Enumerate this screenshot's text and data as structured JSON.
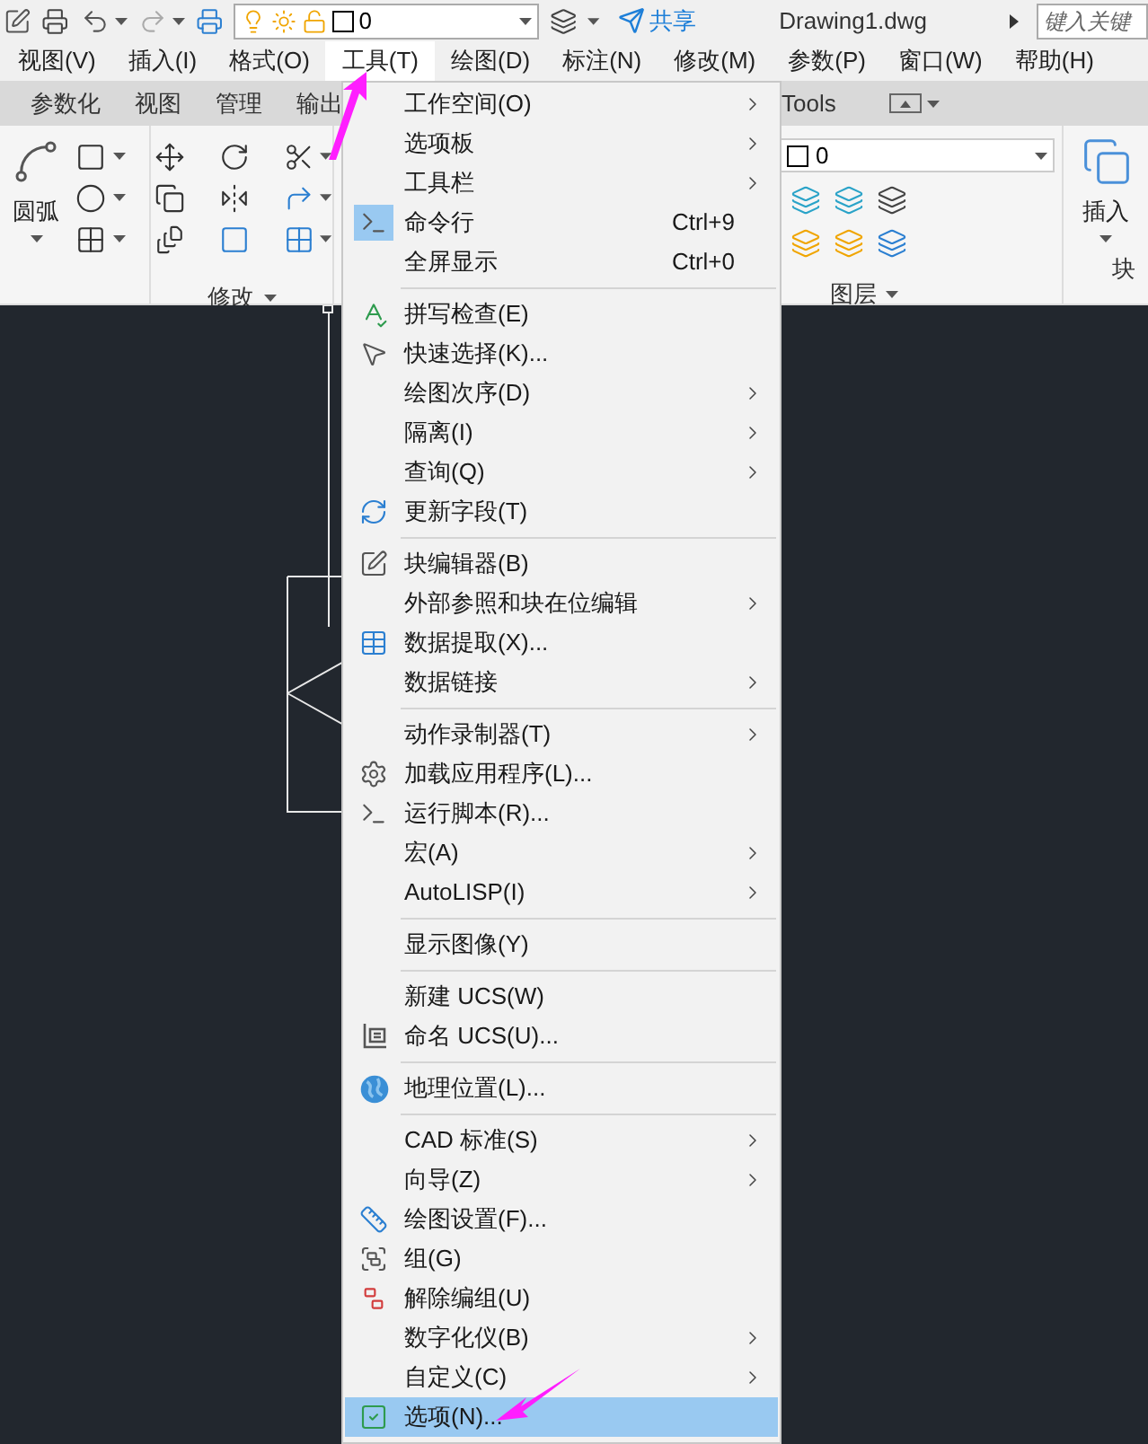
{
  "quick_access": {
    "layer_value": "0",
    "share": "共享",
    "document_title": "Drawing1.dwg",
    "search": {
      "placeholder": "键入关键"
    }
  },
  "menu_bar": [
    {
      "label": "视图(V)",
      "selected": false
    },
    {
      "label": "插入(I)",
      "selected": false
    },
    {
      "label": "格式(O)",
      "selected": false
    },
    {
      "label": "工具(T)",
      "selected": true
    },
    {
      "label": "绘图(D)",
      "selected": false
    },
    {
      "label": "标注(N)",
      "selected": false
    },
    {
      "label": "修改(M)",
      "selected": false
    },
    {
      "label": "参数(P)",
      "selected": false
    },
    {
      "label": "窗口(W)",
      "selected": false
    },
    {
      "label": "帮助(H)",
      "selected": false
    }
  ],
  "ribbon_tabs": [
    {
      "label": "参数化"
    },
    {
      "label": "视图"
    },
    {
      "label": "管理"
    },
    {
      "label": "输出"
    },
    {
      "label": "Tools"
    }
  ],
  "ribbon_panels": {
    "draw_button": "圆弧",
    "modify_label": "修改",
    "layer_value": "0",
    "layer_label": "图层",
    "insert_button": "插入",
    "block_label": "块"
  },
  "tools_menu": {
    "groups": [
      [
        {
          "label": "工作空间(O)",
          "submenu": true,
          "checked": false,
          "selected": false
        },
        {
          "label": "选项板",
          "submenu": true,
          "checked": false,
          "selected": false
        },
        {
          "label": "工具栏",
          "submenu": true,
          "checked": false,
          "selected": false
        },
        {
          "label": "命令行",
          "shortcut": "Ctrl+9",
          "submenu": false,
          "checked": true,
          "selected": false
        },
        {
          "label": "全屏显示",
          "shortcut": "Ctrl+0",
          "submenu": false,
          "checked": false,
          "selected": false
        }
      ],
      [
        {
          "label": "拼写检查(E)",
          "submenu": false,
          "checked": false,
          "selected": false
        },
        {
          "label": "快速选择(K)...",
          "submenu": false,
          "checked": false,
          "selected": false
        },
        {
          "label": "绘图次序(D)",
          "submenu": true,
          "checked": false,
          "selected": false
        },
        {
          "label": "隔离(I)",
          "submenu": true,
          "checked": false,
          "selected": false
        },
        {
          "label": "查询(Q)",
          "submenu": true,
          "checked": false,
          "selected": false
        },
        {
          "label": "更新字段(T)",
          "submenu": false,
          "checked": false,
          "selected": false
        }
      ],
      [
        {
          "label": "块编辑器(B)",
          "submenu": false,
          "checked": false,
          "selected": false
        },
        {
          "label": "外部参照和块在位编辑",
          "submenu": true,
          "checked": false,
          "selected": false
        },
        {
          "label": "数据提取(X)...",
          "submenu": false,
          "checked": false,
          "selected": false
        },
        {
          "label": "数据链接",
          "submenu": true,
          "checked": false,
          "selected": false
        }
      ],
      [
        {
          "label": "动作录制器(T)",
          "submenu": true,
          "checked": false,
          "selected": false
        },
        {
          "label": "加载应用程序(L)...",
          "submenu": false,
          "checked": false,
          "selected": false
        },
        {
          "label": "运行脚本(R)...",
          "submenu": false,
          "checked": false,
          "selected": false
        },
        {
          "label": "宏(A)",
          "submenu": true,
          "checked": false,
          "selected": false
        },
        {
          "label": "AutoLISP(I)",
          "submenu": true,
          "checked": false,
          "selected": false
        }
      ],
      [
        {
          "label": "显示图像(Y)",
          "submenu": false,
          "checked": false,
          "selected": false
        }
      ],
      [
        {
          "label": "新建 UCS(W)",
          "submenu": false,
          "checked": false,
          "selected": false
        },
        {
          "label": "命名 UCS(U)...",
          "submenu": false,
          "checked": false,
          "selected": false
        }
      ],
      [
        {
          "label": "地理位置(L)...",
          "submenu": false,
          "checked": false,
          "selected": false
        }
      ],
      [
        {
          "label": "CAD 标准(S)",
          "submenu": true,
          "checked": false,
          "selected": false
        },
        {
          "label": "向导(Z)",
          "submenu": true,
          "checked": false,
          "selected": false
        },
        {
          "label": "绘图设置(F)...",
          "submenu": false,
          "checked": false,
          "selected": false
        },
        {
          "label": "组(G)",
          "submenu": false,
          "checked": false,
          "selected": false
        },
        {
          "label": "解除编组(U)",
          "submenu": false,
          "checked": false,
          "selected": false
        },
        {
          "label": "数字化仪(B)",
          "submenu": true,
          "checked": false,
          "selected": false
        },
        {
          "label": "自定义(C)",
          "submenu": true,
          "checked": false,
          "selected": false
        },
        {
          "label": "选项(N)...",
          "submenu": false,
          "checked": false,
          "selected": true
        }
      ]
    ]
  }
}
